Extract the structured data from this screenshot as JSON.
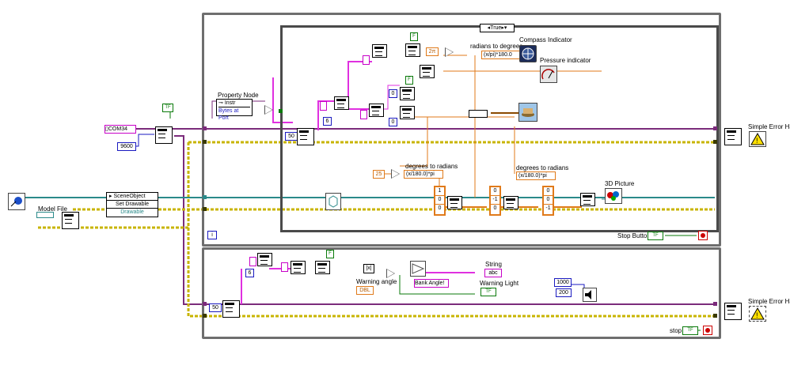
{
  "case_selector": "True",
  "upper": {
    "com_port": "COM34",
    "baud": "9600",
    "property_node": {
      "title": "Property Node",
      "class": "Instr",
      "property": "Bytes at Port"
    },
    "labels": {
      "rad2deg": "radians to degrees",
      "rad2deg_formula": "(x/pi)*180.0",
      "compass": "Compass Indicator",
      "pressure": "Pressure indicator",
      "deg2rad_1": "degrees to radians",
      "deg2rad_1_formula": "(x/180.0)*pi",
      "deg2rad_2": "degrees to radians",
      "deg2rad_2_formula": "(x/180.0)*pi",
      "picture": "3D Picture",
      "stop_button": "Stop Button",
      "error_handler": "Simple Error Handler.vi"
    },
    "constants": {
      "offset": "2π",
      "angle": "25",
      "const_50": "50",
      "idx0a": "0",
      "idx0b": "0",
      "idx6": "6",
      "idx0c": "0"
    },
    "arrays": [
      [
        "1",
        "0",
        "0"
      ],
      [
        "0",
        "-1",
        "0"
      ],
      [
        "0",
        "0",
        "-1"
      ]
    ],
    "loop_index": "i"
  },
  "left": {
    "model_file": "Model File",
    "scene_node": {
      "class": "SceneObject",
      "method": "Set Drawable",
      "param": "Drawable"
    }
  },
  "lower": {
    "const_50": "50",
    "const_6": "6",
    "warning_angle": "Warning angle",
    "bank_angle": "Bank Angle!",
    "string": "String",
    "warning_light": "Warning Light",
    "freq": "1000",
    "dur": "200",
    "stop": "stop",
    "error_handler": "Simple Error Handler.vi"
  },
  "bool_tf": "TF",
  "bool_f": "F"
}
